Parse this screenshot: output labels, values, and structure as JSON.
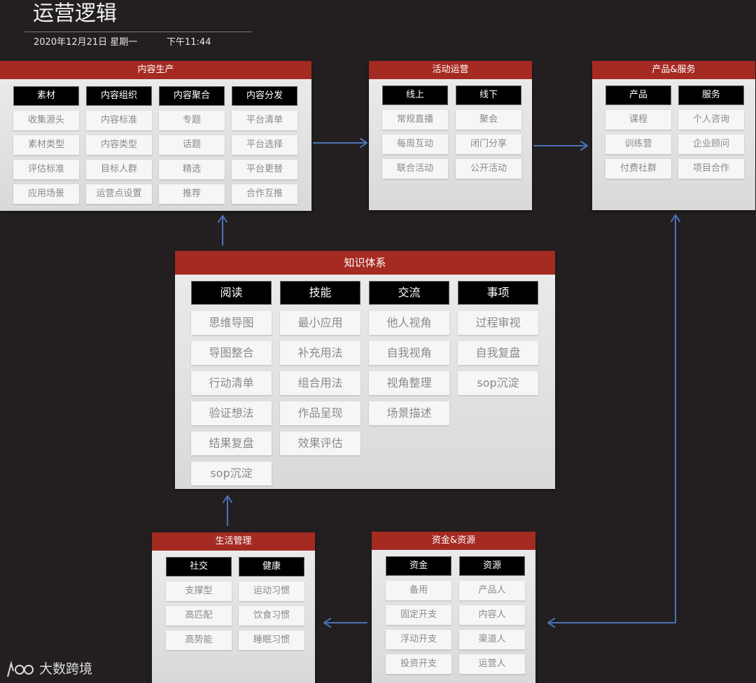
{
  "header": {
    "title": "运营逻辑",
    "date": "2020年12月21日 星期一",
    "time": "下午11:44"
  },
  "panels": {
    "content_production": {
      "title": "内容生产",
      "columns": [
        {
          "header": "素材",
          "items": [
            "收集源头",
            "素材类型",
            "评估标准",
            "应用场景"
          ]
        },
        {
          "header": "内容组织",
          "items": [
            "内容标准",
            "内容类型",
            "目标人群",
            "运营点设置"
          ]
        },
        {
          "header": "内容聚合",
          "items": [
            "专题",
            "话题",
            "精选",
            "推荐"
          ]
        },
        {
          "header": "内容分发",
          "items": [
            "平台清单",
            "平台选择",
            "平台更替",
            "合作互推"
          ]
        }
      ]
    },
    "activity_ops": {
      "title": "活动运营",
      "columns": [
        {
          "header": "线上",
          "items": [
            "常规直播",
            "每周互动",
            "联合活动"
          ]
        },
        {
          "header": "线下",
          "items": [
            "聚会",
            "闭门分享",
            "公开活动"
          ]
        }
      ]
    },
    "products_services": {
      "title": "产品&服务",
      "columns": [
        {
          "header": "产品",
          "items": [
            "课程",
            "训练营",
            "付费社群"
          ]
        },
        {
          "header": "服务",
          "items": [
            "个人咨询",
            "企业顾问",
            "项目合作"
          ]
        }
      ]
    },
    "knowledge_system": {
      "title": "知识体系",
      "columns": [
        {
          "header": "阅读",
          "items": [
            "思维导图",
            "导图整合",
            "行动清单",
            "验证想法",
            "结果复盘",
            "sop沉淀"
          ]
        },
        {
          "header": "技能",
          "items": [
            "最小应用",
            "补充用法",
            "组合用法",
            "作品呈现",
            "效果评估"
          ]
        },
        {
          "header": "交流",
          "items": [
            "他人视角",
            "自我视角",
            "视角整理",
            "场景描述"
          ]
        },
        {
          "header": "事项",
          "items": [
            "过程审视",
            "自我复盘",
            "sop沉淀"
          ]
        }
      ]
    },
    "life_management": {
      "title": "生活管理",
      "columns": [
        {
          "header": "社交",
          "items": [
            "支撑型",
            "高匹配",
            "高势能"
          ]
        },
        {
          "header": "健康",
          "items": [
            "运动习惯",
            "饮食习惯",
            "睡眠习惯"
          ]
        }
      ]
    },
    "funds_resources": {
      "title": "资金&资源",
      "columns": [
        {
          "header": "资金",
          "items": [
            "备用",
            "固定开支",
            "浮动开支",
            "投资开支"
          ]
        },
        {
          "header": "资源",
          "items": [
            "产品人",
            "内容人",
            "渠道人",
            "运营人"
          ]
        }
      ]
    }
  },
  "watermark": {
    "text": "大数跨境"
  },
  "colors": {
    "background": "#231f20",
    "panel_header": "#a52a22",
    "column_header": "#000000",
    "cell": "#f6f6f6",
    "cell_text": "#8a8a8a",
    "arrow": "#4a72b8"
  }
}
